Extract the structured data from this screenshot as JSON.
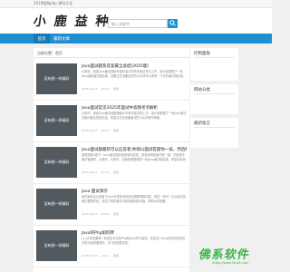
{
  "topbar": {
    "text": "2019团购php 源码大全"
  },
  "header": {
    "logo_text": "小 鹿 益 种",
    "search_placeholder": "输入关键字"
  },
  "nav": {
    "items": [
      "首页",
      "最新文章"
    ]
  },
  "breadcrumb": "当前位置：首页",
  "posts": [
    {
      "thumb": "没有图一样精彩",
      "title": "Java面试题及答案最全总结(2025版)",
      "excerpt": "大家好，我是Java面试题库专题作者中的有关面试来引工作，用大家整理了一份Java最新面试题合集，如果正在准备面试的小伙伴可以参考一下这份面试题合集。",
      "date": "2025-04-27",
      "author": "admin",
      "views": "查看"
    },
    {
      "thumb": "没有图一样精彩",
      "title": "Java面试常见2025年面试中高频考点解析",
      "excerpt": "大家好，我是Java面试题整理者分享有关面试的工作，用大家整理了一份Java面试高频问题及答案总结，希望对正在准备面试的小伙伴有所帮助。",
      "date": "2025-04-27",
      "author": "admin",
      "views": "查看"
    },
    {
      "thumb": "没有图一样精彩",
      "title": "Java面试题最新可以应答者,你即以面试官题你一技，然后解析?",
      "excerpt": "原则题第2题下：Java面试题目就是给你发的。回答他就是面试官一题，你就是不面试管理的，大家好，大家好，这就是我整理的一份Java面试题合集，希望对你有所帮助。",
      "date": "2025-04-27",
      "author": "admin",
      "views": "查看"
    },
    {
      "thumb": "没有图一样精彩",
      "title": "Java 面试演示",
      "excerpt": "我们接着会认真做了Java开发技术的面试题整理和收集，现在一些大厂企业面试答案已整理完成，总结了很多面试中经常遇到的问题，帮助大家准备。",
      "date": "2025-04-27",
      "author": "admin",
      "views": "查看"
    },
    {
      "thumb": "没有图一样精彩",
      "title": "Java的Php如何转",
      "excerpt": "(上)大学就要有一种真实可靠的Php转Java学习经验，其实这个Java的知识是实际开发中经常遇到的，学习转型要坚持。",
      "date": "2025-04-27",
      "author": "admin",
      "views": "查看"
    }
  ],
  "sidebar": {
    "sections": [
      "控制面板",
      "网站分类",
      "最新留言"
    ]
  },
  "watermark": {
    "text": "佛系软件",
    "sub": "https://www.fosoft.com"
  }
}
